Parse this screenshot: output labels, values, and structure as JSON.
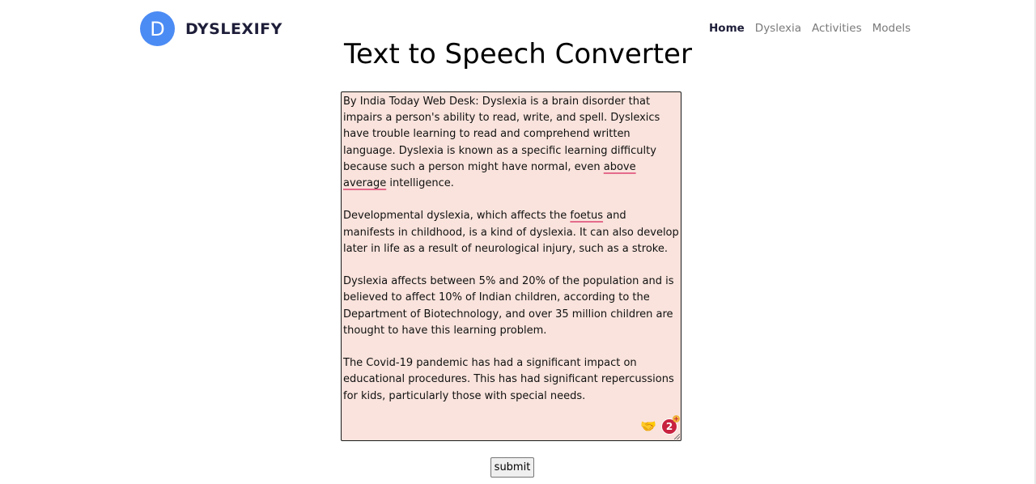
{
  "brand": {
    "logo_letter": "D",
    "name": "DYSLEXIFY"
  },
  "nav": {
    "items": [
      {
        "label": "Home",
        "active": true
      },
      {
        "label": "Dyslexia",
        "active": false
      },
      {
        "label": "Activities",
        "active": false
      },
      {
        "label": "Models",
        "active": false
      }
    ]
  },
  "title": "Text to Speech Converter",
  "textbox": {
    "p1_pre": "By India Today Web Desk: Dyslexia is a brain disorder that impairs a person's ability to read, write, and spell. Dyslexics have trouble learning to read and comprehend written language. Dyslexia is known as a specific learning difficulty because such a person might have normal, even ",
    "p1_mark": "above average",
    "p1_post": " intelligence.",
    "p2_pre": "Developmental dyslexia, which affects the ",
    "p2_mark": "foetus",
    "p2_post": " and manifests in childhood, is a kind of dyslexia. It can also develop later in life as a result of neurological injury, such as a stroke.",
    "p3": "Dyslexia affects between 5% and 20% of the population and is believed to affect 10% of Indian children, according to the Department of Biotechnology, and over 35 million children are thought to have this learning problem.",
    "p4": "The Covid-19 pandemic has had a significant impact on educational procedures. This has had significant repercussions for kids, particularly those with special needs.",
    "badge_count": "2",
    "badge_plus": "+"
  },
  "submit_label": "submit",
  "colors": {
    "logo": "#4b8bf4",
    "textbox_bg": "#f9e3dc",
    "spell_underline": "#e46b8c"
  }
}
